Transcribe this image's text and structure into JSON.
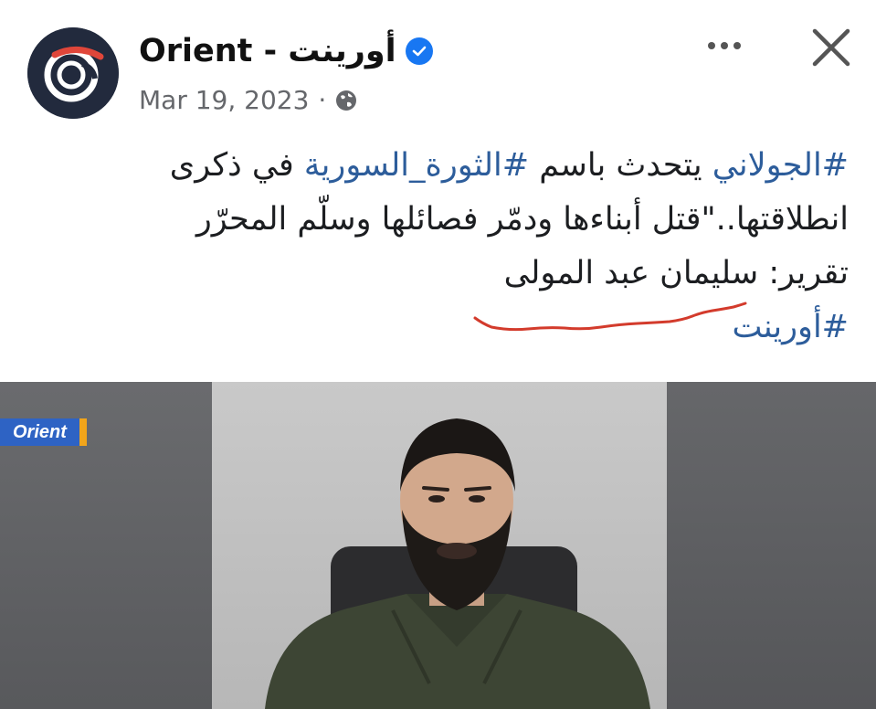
{
  "post": {
    "page_name": "Orient - أورينت",
    "date": "Mar 19, 2023",
    "separator": "·",
    "audience_icon": "globe-icon",
    "verified_icon": "verified-badge-icon",
    "lines": [
      {
        "hashtag1": "#الجولاني",
        "text1": " يتحدث باسم ",
        "hashtag2": "#الثورة_السورية",
        "text2": " في ذكرى"
      },
      {
        "text": "انطلاقتها..\"قتل أبناءها ودمّر فصائلها وسلّم المحرّر"
      },
      {
        "text": "تقرير: سليمان عبد المولى"
      },
      {
        "hashtag": "#أورينت"
      }
    ]
  },
  "video": {
    "channel_logo": "Orient"
  },
  "colors": {
    "hashtag": "#2d5d9b",
    "verified": "#1877f2",
    "logo_bar": "#2e63c4",
    "logo_accent": "#f2a51a",
    "annotation": "#d33b2c"
  }
}
